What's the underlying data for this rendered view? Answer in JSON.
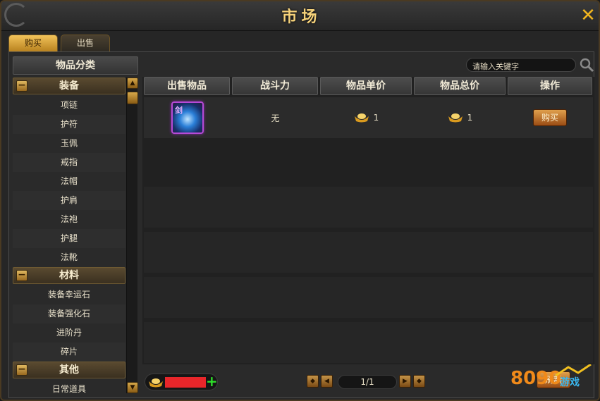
{
  "window": {
    "title": "市场"
  },
  "tabs": [
    {
      "label": "购买",
      "active": true
    },
    {
      "label": "出售",
      "active": false
    }
  ],
  "sidebar": {
    "title": "物品分类",
    "categories": [
      {
        "label": "装备",
        "items": [
          "项链",
          "护符",
          "玉佩",
          "戒指",
          "法帽",
          "护肩",
          "法袍",
          "护腿",
          "法靴"
        ]
      },
      {
        "label": "材料",
        "items": [
          "装备幸运石",
          "装备强化石",
          "进阶丹",
          "碎片"
        ]
      },
      {
        "label": "其他",
        "items": [
          "日常道具"
        ]
      }
    ]
  },
  "search": {
    "placeholder": "请输入关键字"
  },
  "table": {
    "headers": [
      "出售物品",
      "战斗力",
      "物品单价",
      "物品总价",
      "操作"
    ],
    "rows": [
      {
        "item_tag": "剑",
        "power": "无",
        "unit_price": "1",
        "total_price": "1",
        "action": "购买"
      }
    ]
  },
  "footer": {
    "page": "1/1",
    "refresh_label": "刷新"
  },
  "watermark": {
    "text": "8090游戏"
  },
  "colors": {
    "accent": "#f3b61f",
    "title": "#f6d27a",
    "currency_bar": "#e8262a",
    "plus": "#2ee02a",
    "item_border": "#b64ad6"
  }
}
